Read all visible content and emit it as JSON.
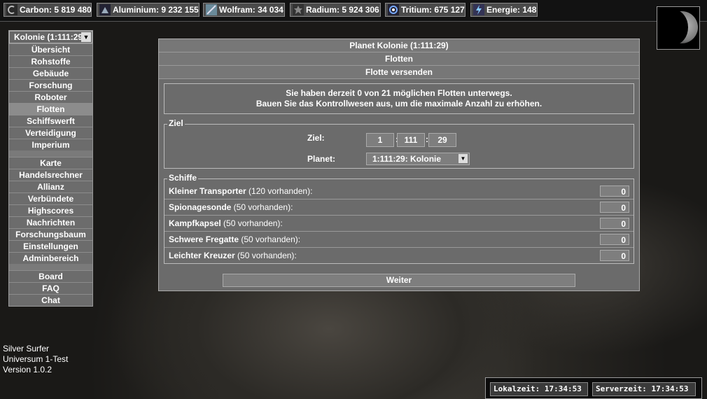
{
  "resources": [
    {
      "icon": "carbon-icon",
      "label": "Carbon: 5 819 480"
    },
    {
      "icon": "aluminium-icon",
      "label": "Aluminium: 9 232 155"
    },
    {
      "icon": "wolfram-icon",
      "label": "Wolfram: 34 034"
    },
    {
      "icon": "radium-icon",
      "label": "Radium: 5 924 306"
    },
    {
      "icon": "tritium-icon",
      "label": "Tritium: 675 127"
    },
    {
      "icon": "energie-icon",
      "label": "Energie: 148"
    }
  ],
  "nav": {
    "colony_select": "Kolonie (1:111:29",
    "group1": [
      "Übersicht",
      "Rohstoffe",
      "Gebäude",
      "Forschung",
      "Roboter",
      "Flotten",
      "Schiffswerft",
      "Verteidigung",
      "Imperium"
    ],
    "group2": [
      "Karte",
      "Handelsrechner",
      "Allianz",
      "Verbündete",
      "Highscores",
      "Nachrichten",
      "Forschungsbaum",
      "Einstellungen",
      "Adminbereich"
    ],
    "group3": [
      "Board",
      "FAQ",
      "Chat"
    ]
  },
  "panel": {
    "title": "Planet Kolonie (1:111:29)",
    "section": "Flotten",
    "subsection": "Flotte versenden",
    "info_line1": "Sie haben derzeit 0 von 21 möglichen Flotten unterwegs.",
    "info_line2": "Bauen Sie das Kontrollwesen aus, um die maximale Anzahl zu erhöhen.",
    "ziel_legend": "Ziel",
    "ziel_label": "Ziel:",
    "coord_galaxy": "1",
    "coord_system": "111",
    "coord_position": "29",
    "coord_sep": ":",
    "planet_label": "Planet:",
    "planet_value": "1:111:29: Kolonie",
    "schiffe_legend": "Schiffe",
    "ships": [
      {
        "name": "Kleiner Transporter",
        "avail": " (120 vorhanden):",
        "value": "0"
      },
      {
        "name": "Spionagesonde",
        "avail": " (50 vorhanden):",
        "value": "0"
      },
      {
        "name": "Kampfkapsel",
        "avail": " (50 vorhanden):",
        "value": "0"
      },
      {
        "name": "Schwere Fregatte",
        "avail": " (50 vorhanden):",
        "value": "0"
      },
      {
        "name": "Leichter Kreuzer",
        "avail": " (50 vorhanden):",
        "value": "0"
      }
    ],
    "weiter": "Weiter"
  },
  "footer": {
    "line1": "Silver Surfer",
    "line2": "Universum 1-Test",
    "line3": "Version 1.0.2"
  },
  "clock": {
    "local": "Lokalzeit: 17:34:53",
    "server": "Serverzeit: 17:34:53"
  }
}
